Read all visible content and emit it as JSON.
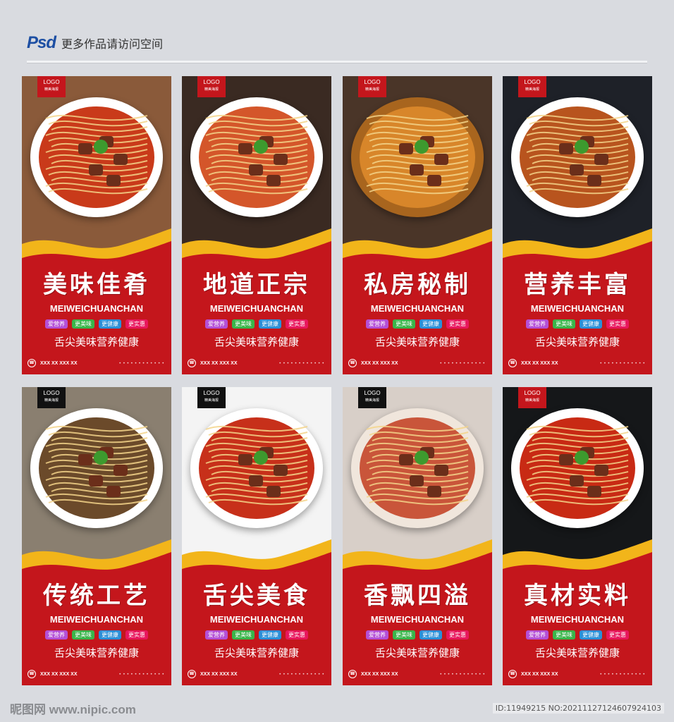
{
  "header": {
    "badge": "Psd",
    "text": "更多作品请访问空间"
  },
  "cards": [
    {
      "headline": "美味佳肴",
      "logo_dark": false,
      "bg": "#8a5a3a",
      "bowl": "#ffffff",
      "soup": "#c93a1a"
    },
    {
      "headline": "地道正宗",
      "logo_dark": false,
      "bg": "#3a2a22",
      "bowl": "#ffffff",
      "soup": "#d4562a"
    },
    {
      "headline": "私房秘制",
      "logo_dark": false,
      "bg": "#4a3528",
      "bowl": "#a8651e",
      "soup": "#d8862a"
    },
    {
      "headline": "营养丰富",
      "logo_dark": false,
      "bg": "#1e2128",
      "bowl": "#ffffff",
      "soup": "#b8541e"
    },
    {
      "headline": "传统工艺",
      "logo_dark": true,
      "bg": "#8a7f70",
      "bowl": "#ffffff",
      "soup": "#6b4a2a"
    },
    {
      "headline": "舌尖美食",
      "logo_dark": true,
      "bg": "#f4f4f4",
      "bowl": "#ffffff",
      "soup": "#c7301a"
    },
    {
      "headline": "香飘四溢",
      "logo_dark": true,
      "bg": "#d8cfc8",
      "bowl": "#f0e6dc",
      "soup": "#c9553a"
    },
    {
      "headline": "真材实料",
      "logo_dark": false,
      "bg": "#151719",
      "bowl": "#ffffff",
      "soup": "#c82a14"
    }
  ],
  "common": {
    "logo_title": "LOGO",
    "logo_sub": "精美海报",
    "pinyin": "MEIWEICHUANCHAN",
    "tags": [
      "爱营养",
      "更美味",
      "更健康",
      "更实惠"
    ],
    "slogan": "舌尖美味营养健康",
    "footer_phone": "XXX XX XXX XX"
  },
  "watermark": {
    "left": "昵图网 www.nipic.com",
    "right": "ID:11949215 NO:20211127124607924103"
  },
  "colors": {
    "poster_red": "#c4161c",
    "wave_gold": "#f2b51a",
    "page_bg": "#d9dbe0"
  }
}
